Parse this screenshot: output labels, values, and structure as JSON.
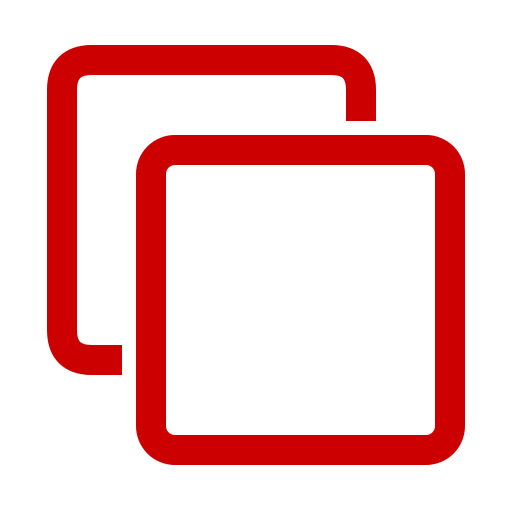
{
  "icon": {
    "name": "copy-icon",
    "color": "#cc0000",
    "background": "#ffffff"
  }
}
